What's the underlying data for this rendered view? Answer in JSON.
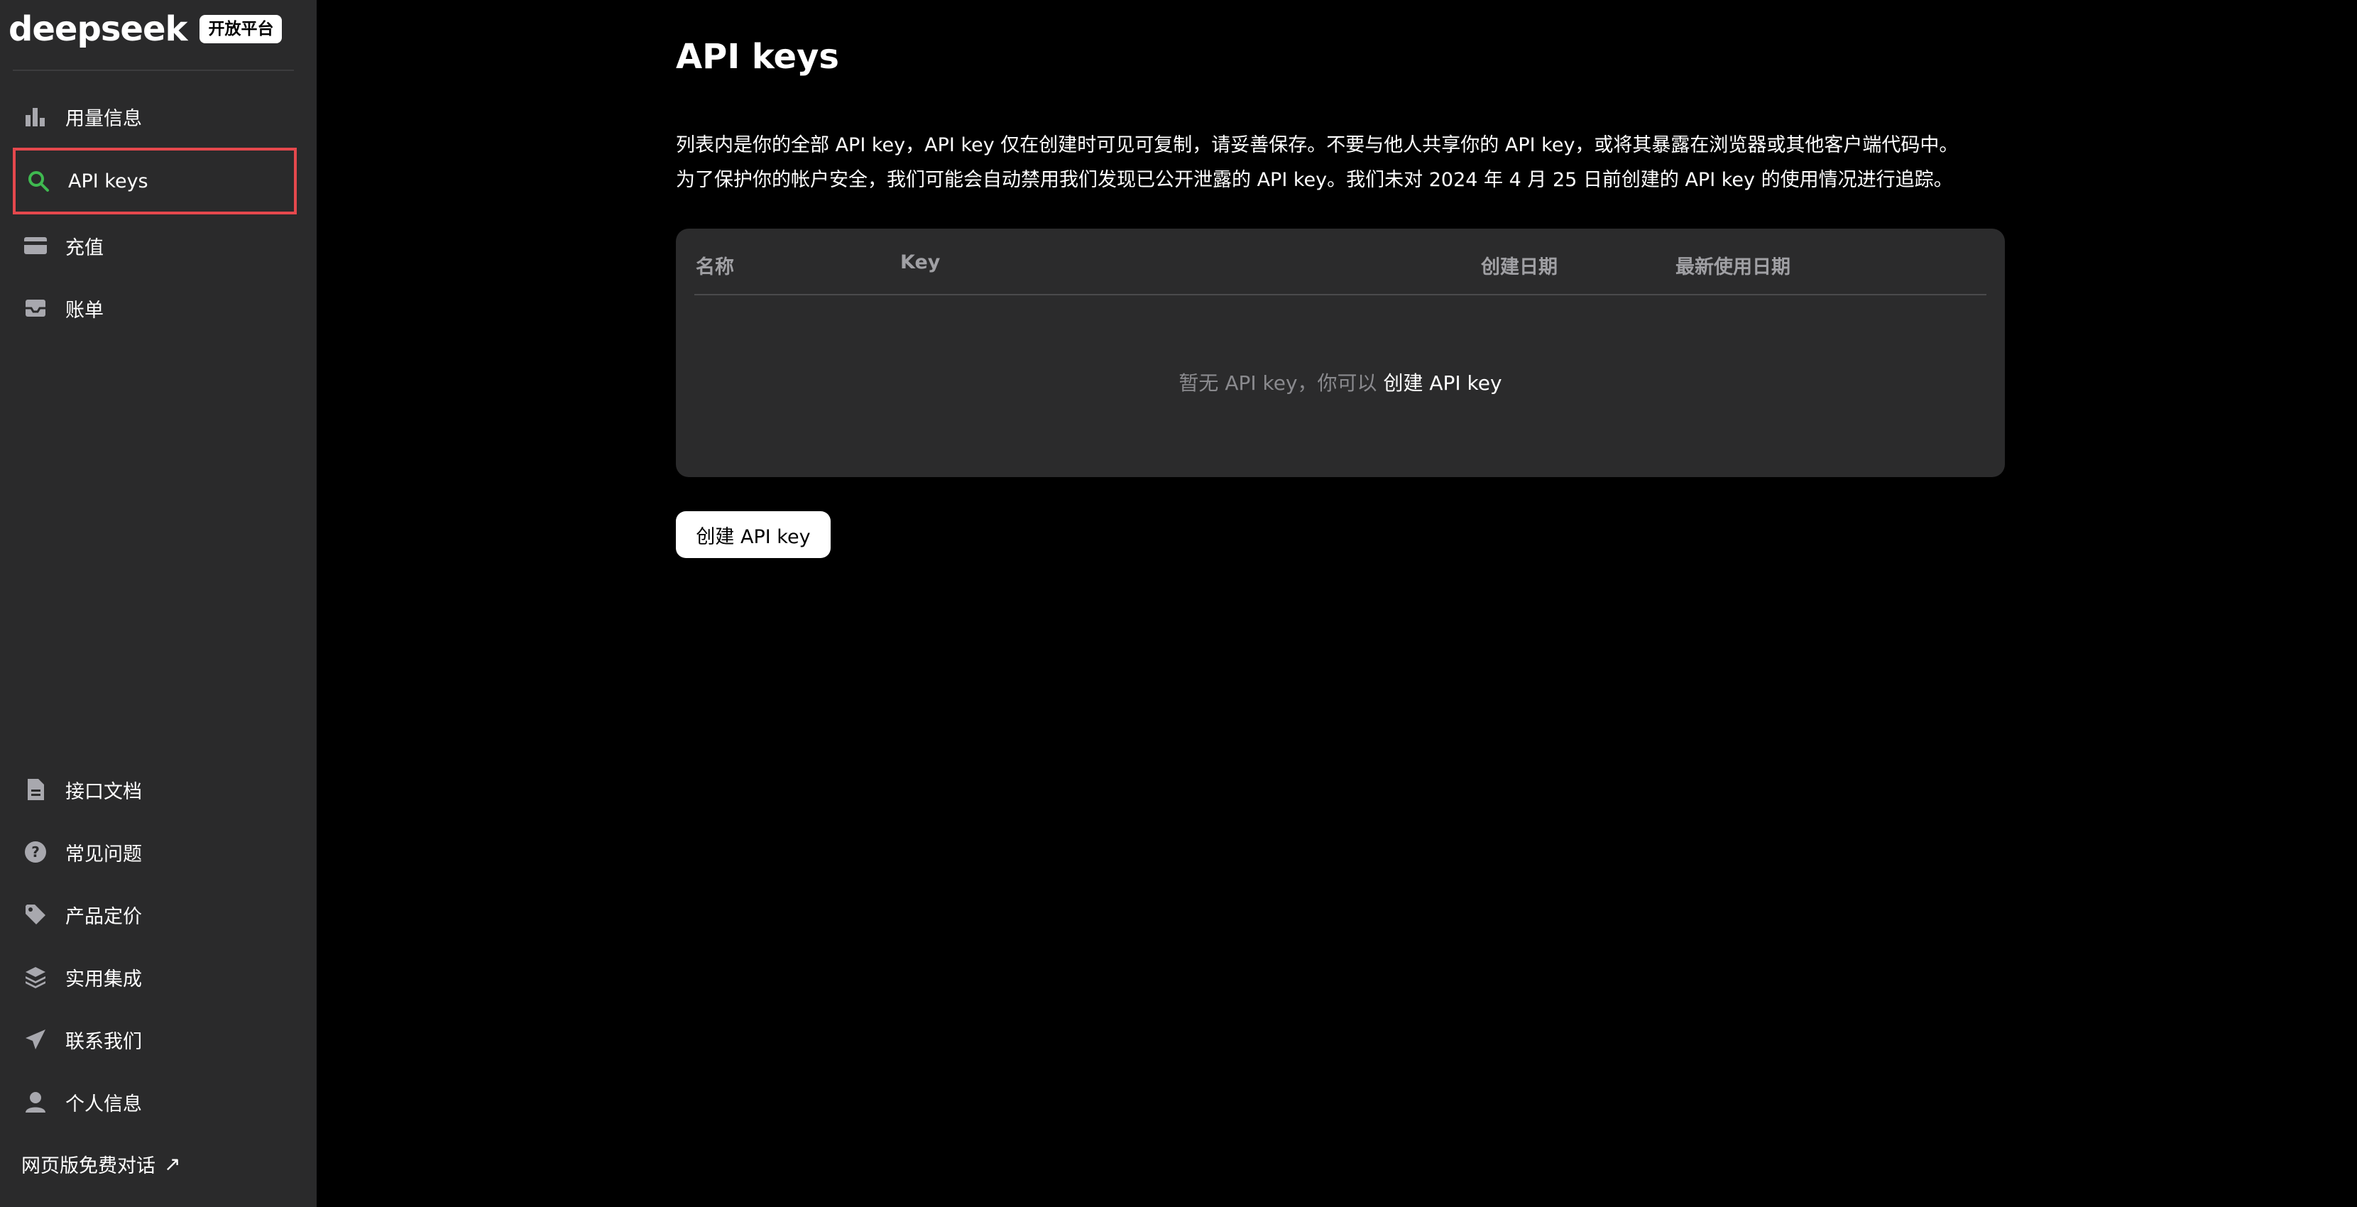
{
  "brand": {
    "logo_text": "deepseek",
    "badge": "开放平台"
  },
  "sidebar": {
    "top_items": [
      {
        "label": "用量信息",
        "icon": "bar-chart-icon"
      },
      {
        "label": "API keys",
        "icon": "search-key-icon",
        "active": true
      },
      {
        "label": "充值",
        "icon": "card-icon"
      },
      {
        "label": "账单",
        "icon": "inbox-icon"
      }
    ],
    "bottom_items": [
      {
        "label": "接口文档",
        "icon": "document-icon"
      },
      {
        "label": "常见问题",
        "icon": "question-icon"
      },
      {
        "label": "产品定价",
        "icon": "tag-icon"
      },
      {
        "label": "实用集成",
        "icon": "layers-icon"
      },
      {
        "label": "联系我们",
        "icon": "send-icon"
      },
      {
        "label": "个人信息",
        "icon": "user-icon"
      }
    ],
    "web_link": {
      "label": "网页版免费对话",
      "arrow": "↗"
    }
  },
  "main": {
    "title": "API keys",
    "description": [
      "列表内是你的全部 API key，API key 仅在创建时可见可复制，请妥善保存。不要与他人共享你的 API key，或将其暴露在浏览器或其他客户端代码中。",
      "为了保护你的帐户安全，我们可能会自动禁用我们发现已公开泄露的 API key。我们未对 2024 年 4 月 25 日前创建的 API key 的使用情况进行追踪。"
    ],
    "table": {
      "columns": [
        "名称",
        "Key",
        "创建日期",
        "最新使用日期"
      ],
      "empty_text": "暂无 API key，你可以 ",
      "empty_link": "创建 API key"
    },
    "create_button": "创建 API key"
  },
  "colors": {
    "sidebar_bg": "#2a2a2b",
    "main_bg": "#000000",
    "card_bg": "#2b2b2c",
    "active_border": "#e5484d",
    "active_icon": "#3fb950",
    "icon_gray": "#a8a8ae"
  }
}
